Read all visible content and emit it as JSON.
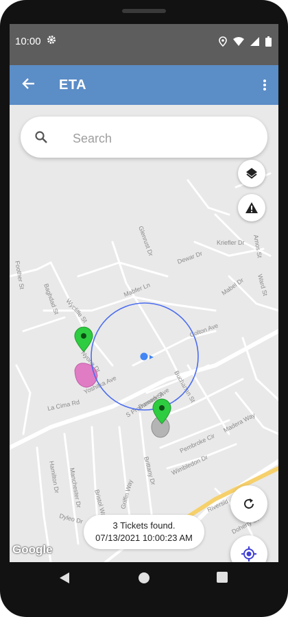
{
  "status_bar": {
    "time": "10:00",
    "icons": [
      "settings-icon",
      "location-icon",
      "wifi-icon",
      "signal-icon",
      "battery-icon"
    ]
  },
  "app_bar": {
    "title": "ETA",
    "back_icon": "arrow-back-icon",
    "menu_icon": "more-vert-icon"
  },
  "search": {
    "placeholder": "Search"
  },
  "map": {
    "streets": [
      "Kriefler Dr",
      "Amos St",
      "Glenrust Dr",
      "Dewar Dr",
      "Foother St",
      "Baghdad St",
      "Wycliffe St",
      "Mabfer Ln",
      "Colton Ave",
      "Nyona Dr",
      "Yoshitka Ave",
      "La Cima Rd",
      "S Promenade Ave",
      "Doreen St",
      "Buchanan St",
      "Brittany Dr",
      "Pembroke Cir",
      "Wimbledon Dr",
      "Riversid",
      "Bristol Way",
      "Griffin Way",
      "Hamilton Dr",
      "Manchester Dr",
      "Madera Way",
      "Doherty St",
      "Dyleo Dr",
      "Mabel Dr",
      "Ward St"
    ],
    "attribution": "Google",
    "markers": [
      {
        "name": "ticket-1",
        "color": "#2ecc40",
        "area_color": "#e07cc4"
      },
      {
        "name": "ticket-2",
        "color": "#2ecc40",
        "area_color": "#b4b4b4"
      }
    ],
    "radius_color": "#4a6cf0",
    "user_location_color": "#4285f4"
  },
  "controls": {
    "layers_icon": "layers-icon",
    "alert_icon": "warning-icon",
    "refresh_icon": "refresh-icon",
    "my_location_icon": "my-location-icon"
  },
  "toast": {
    "line1": "3 Tickets found.",
    "line2": "07/13/2021 10:00:23 AM"
  },
  "nav_bar": {
    "icons": [
      "back-triangle-icon",
      "home-circle-icon",
      "recents-square-icon"
    ]
  }
}
